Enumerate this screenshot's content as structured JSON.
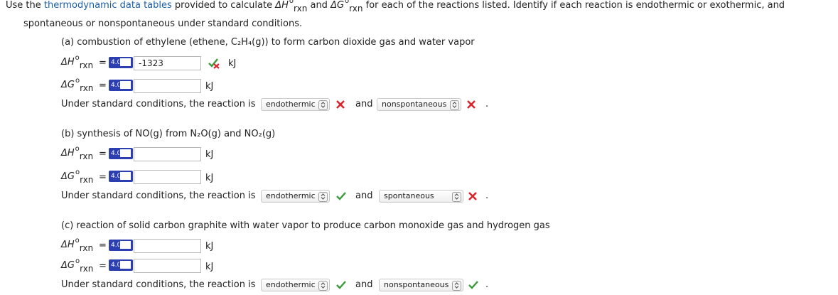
{
  "intro": {
    "text1": "Use the ",
    "link": "thermodynamic data tables",
    "text2": " provided to calculate ",
    "sym_h": "ΔH",
    "and": " and ",
    "sym_g": "ΔG",
    "text3": " for each of the reactions listed. Identify if each reaction is endothermic or exothermic, and",
    "line2": "spontaneous or nonspontaneous under standard conditions."
  },
  "labels": {
    "rxn": "rxn",
    "degree": "o",
    "equals": "=",
    "unit": "kJ",
    "badge": "4.0",
    "under": "Under standard conditions, the reaction is",
    "and": "and",
    "period": "."
  },
  "parts": {
    "a": {
      "title": "(a) combustion of ethylene (ethene, C₂H₄(g)) to form carbon dioxide gas and water vapor",
      "dh_value": "-1323",
      "dg_value": "",
      "select1": "endothermic",
      "select2": "nonspontaneous",
      "dh_feedback": "partial",
      "select1_feedback": "incorrect",
      "select2_feedback": "incorrect"
    },
    "b": {
      "title": "(b) synthesis of NO(g) from N₂O(g) and NO₂(g)",
      "dh_value": "",
      "dg_value": "",
      "select1": "endothermic",
      "select2": "spontaneous",
      "select1_feedback": "correct",
      "select2_feedback": "incorrect"
    },
    "c": {
      "title": "(c) reaction of solid carbon graphite with water vapor to produce carbon monoxide gas and hydrogen gas",
      "dh_value": "",
      "dg_value": "",
      "select1": "endothermic",
      "select2": "nonspontaneous",
      "select1_feedback": "correct",
      "select2_feedback": "correct"
    }
  },
  "colors": {
    "link": "#1a5ea8",
    "badge": "#2c3fb0",
    "correct": "#3a9a3a",
    "incorrect": "#d8262e"
  }
}
